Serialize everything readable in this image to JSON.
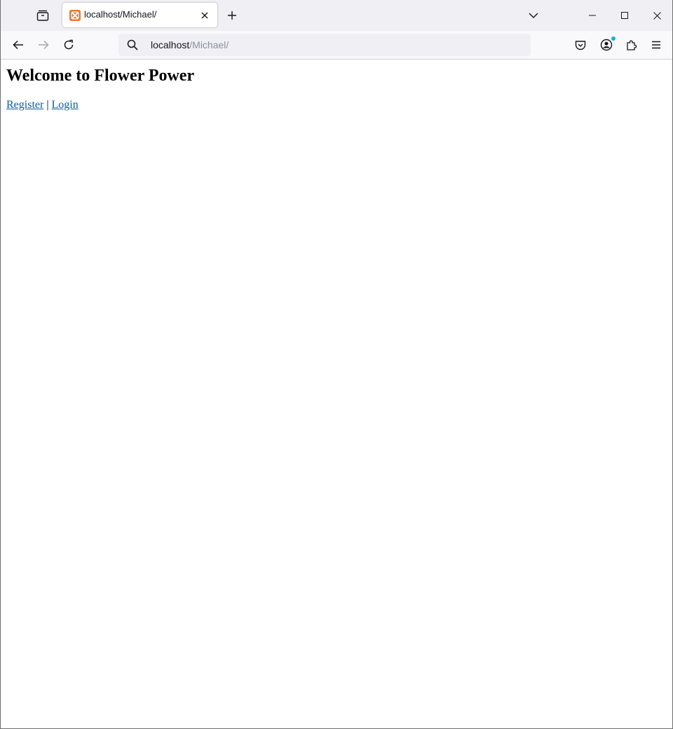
{
  "browser": {
    "tab": {
      "title": "localhost/Michael/",
      "favicon": "xampp-icon"
    },
    "urlbar": {
      "host": "localhost",
      "path": "/Michael/"
    },
    "accent_color": "#0a64c8",
    "favicon_color": "#e8782e",
    "badge_color": "#0ab3e6"
  },
  "page": {
    "heading": "Welcome to Flower Power",
    "links": {
      "register": "Register",
      "separator": " | ",
      "login": "Login"
    },
    "link_color": "#0b5cad"
  }
}
